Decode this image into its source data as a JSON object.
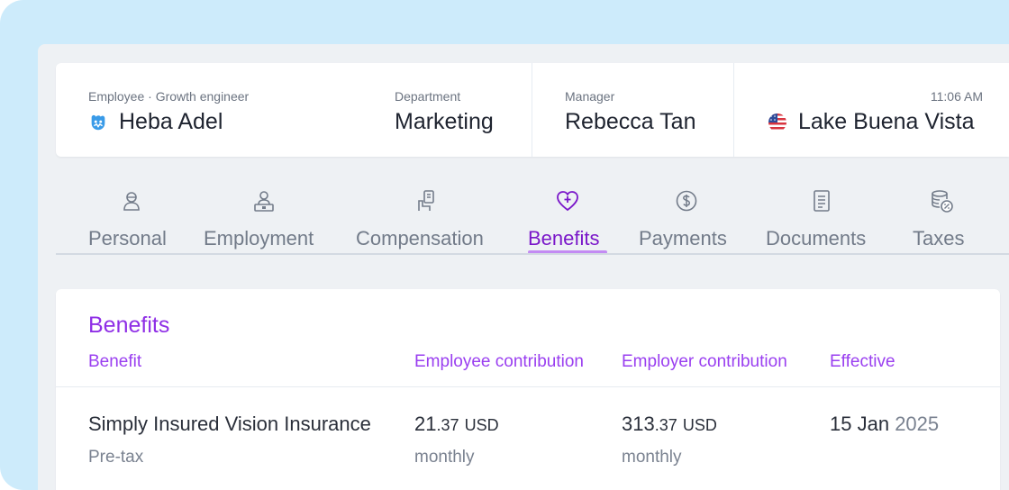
{
  "header": {
    "employee": {
      "label": "Employee · Growth engineer",
      "name": "Heba Adel",
      "icon": "employee-mascot-icon"
    },
    "department": {
      "label": "Department",
      "value": "Marketing"
    },
    "manager": {
      "label": "Manager",
      "value": "Rebecca Tan"
    },
    "location": {
      "time": "11:06 AM",
      "value": "Lake Buena Vista",
      "icon": "us-flag-icon"
    }
  },
  "tabs": [
    {
      "label": "Personal",
      "icon": "person-icon"
    },
    {
      "label": "Employment",
      "icon": "employee-desk-icon"
    },
    {
      "label": "Compensation",
      "icon": "hand-money-icon"
    },
    {
      "label": "Benefits",
      "icon": "heart-plus-icon",
      "active": true
    },
    {
      "label": "Payments",
      "icon": "dollar-circle-icon"
    },
    {
      "label": "Documents",
      "icon": "document-icon"
    },
    {
      "label": "Taxes",
      "icon": "coins-percent-icon"
    }
  ],
  "benefits": {
    "title": "Benefits",
    "columns": [
      "Benefit",
      "Employee contribution",
      "Employer contribution",
      "Effective"
    ],
    "rows": [
      {
        "name": "Simply Insured Vision Insurance",
        "tax": "Pre-tax",
        "employee": {
          "whole": "21",
          "cents": ".37",
          "currency": "USD",
          "period": "monthly"
        },
        "employer": {
          "whole": "313",
          "cents": ".37",
          "currency": "USD",
          "period": "monthly"
        },
        "effective": {
          "day_month": "15 Jan",
          "year": "2025"
        }
      }
    ]
  },
  "colors": {
    "accent": "#8f2fe6",
    "active_tab": "#7a17c9",
    "underline": "#c38bf3",
    "frame": "#cdebfb"
  }
}
